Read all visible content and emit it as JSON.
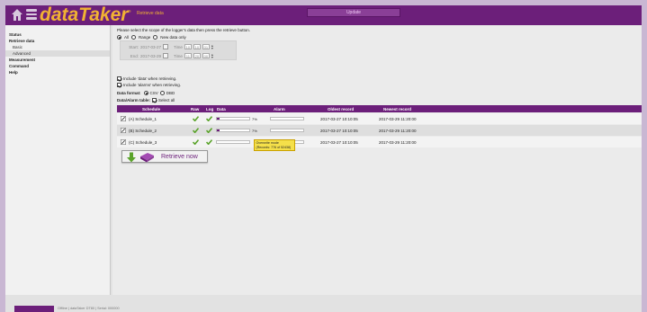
{
  "header": {
    "logo_text": "dataTaker",
    "logo_mark": "®",
    "page_title": "Retrieve data",
    "update_label": "Update"
  },
  "sidebar": {
    "items": [
      {
        "label": "Status"
      },
      {
        "label": "Retrieve data"
      },
      {
        "label": "Basic"
      },
      {
        "label": "Advanced"
      },
      {
        "label": "Measurement"
      },
      {
        "label": "Command"
      },
      {
        "label": "Help"
      }
    ]
  },
  "main": {
    "intro": "Please select the scope of the logger's data then press the retrieve button.",
    "scope": {
      "all": "All",
      "range": "Range",
      "new_only": "New data only",
      "selected": "All"
    },
    "range": {
      "start_label": "Start:",
      "start_date": "2017-03-27",
      "start_time_label": "Time",
      "start_time": [
        "10",
        "10",
        "01"
      ],
      "end_label": "End:",
      "end_date": "2017-03-29",
      "end_time_label": "Time",
      "end_time": [
        "11",
        "20",
        "00"
      ]
    },
    "include_data": "Include 'data' when retrieving.",
    "include_alarms": "Include 'alarms' when retrieving.",
    "format_label": "Data format:",
    "format_csv": "CSV",
    "format_dbd": "DBD",
    "format_selected": "CSV",
    "table_label": "Data/Alarm table:",
    "select_all": "Select all"
  },
  "table": {
    "headers": [
      "Schedule",
      "Raw",
      "Log",
      "Data",
      "Alarm",
      "Oldest record",
      "Newest record"
    ],
    "rows": [
      {
        "name": "(A) Schedule_1",
        "data_pct": "7%",
        "data_fill": 0.07,
        "oldest": "2017-03-27 10:10:05",
        "newest": "2017-03-29 11:20:00"
      },
      {
        "name": "(B) Schedule_2",
        "data_pct": "7%",
        "data_fill": 0.07,
        "oldest": "2017-03-27 10:10:05",
        "newest": "2017-03-29 11:20:00"
      },
      {
        "name": "(C) Schedule_3",
        "data_pct": "",
        "data_fill": 0.0,
        "oldest": "2017-03-27 10:10:05",
        "newest": "2017-03-29 11:20:00"
      }
    ]
  },
  "tooltip": {
    "line1": "Overwrite mode",
    "line2": "(Records: 776 of 52438)"
  },
  "retrieve_button": "Retrieve now",
  "footer": {
    "text": "Offline | dataTaker DT80 | Serial: 000000"
  },
  "colors": {
    "brand": "#6c1f7a",
    "accent": "#f1b233",
    "check": "#5aa32a"
  }
}
